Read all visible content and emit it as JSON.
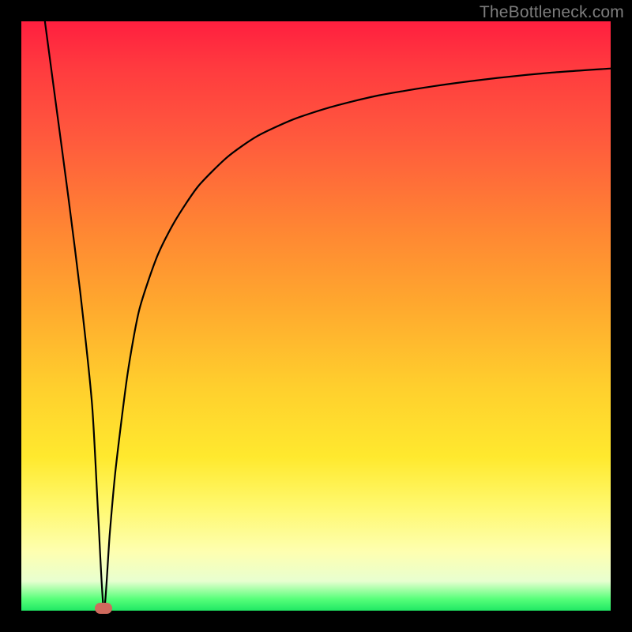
{
  "watermark": "TheBottleneck.com",
  "chart_data": {
    "type": "line",
    "title": "",
    "xlabel": "",
    "ylabel": "",
    "xlim": [
      0,
      100
    ],
    "ylim": [
      0,
      100
    ],
    "grid": false,
    "series": [
      {
        "name": "bottleneck-curve",
        "x": [
          4,
          6,
          8,
          10,
          12,
          13,
          14,
          15,
          16,
          18,
          20,
          23,
          26,
          30,
          35,
          40,
          46,
          52,
          60,
          70,
          80,
          90,
          100
        ],
        "y": [
          100,
          85,
          70,
          54,
          35,
          17,
          0,
          13,
          24,
          40,
          51,
          60,
          66,
          72,
          77,
          80.5,
          83.3,
          85.3,
          87.3,
          89,
          90.3,
          91.3,
          92
        ]
      }
    ],
    "marker": {
      "x": 14,
      "y": 0
    },
    "background_gradient": {
      "top": "#ff1f3f",
      "mid_upper": "#ff8533",
      "mid": "#ffe92e",
      "mid_lower": "#feffb0",
      "bottom": "#20e864"
    }
  }
}
